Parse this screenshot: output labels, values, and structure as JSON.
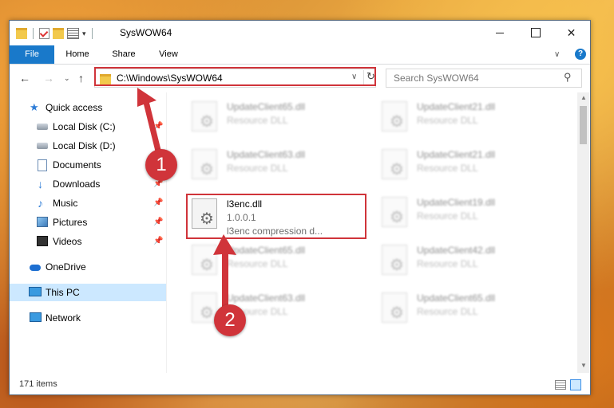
{
  "window": {
    "title": "SysWOW64",
    "minimize_glyph": "",
    "maximize_glyph": "",
    "close_glyph": "✕"
  },
  "ribbon": {
    "tabs": [
      "File",
      "Home",
      "Share",
      "View"
    ],
    "help_glyph": "?",
    "expand_glyph": "∨"
  },
  "nav": {
    "back_glyph": "←",
    "forward_glyph": "→",
    "recent_glyph": "⌄",
    "up_glyph": "↑",
    "address": "C:\\Windows\\SysWOW64",
    "address_chevron": "∨",
    "refresh_glyph": "↻",
    "search_placeholder": "Search SysWOW64",
    "search_glyph": "⚲"
  },
  "sidebar": {
    "items": [
      {
        "label": "Quick access",
        "icon": "star-icon",
        "pinned": false
      },
      {
        "label": "Local Disk (C:)",
        "icon": "disk-icon",
        "pinned": true
      },
      {
        "label": "Local Disk (D:)",
        "icon": "disk-icon",
        "pinned": false
      },
      {
        "label": "Documents",
        "icon": "document-icon",
        "pinned": true
      },
      {
        "label": "Downloads",
        "icon": "download-icon",
        "pinned": true
      },
      {
        "label": "Music",
        "icon": "music-icon",
        "pinned": true
      },
      {
        "label": "Pictures",
        "icon": "pictures-icon",
        "pinned": true
      },
      {
        "label": "Videos",
        "icon": "videos-icon",
        "pinned": true
      },
      {
        "label": "OneDrive",
        "icon": "cloud-icon",
        "pinned": false
      },
      {
        "label": "This PC",
        "icon": "pc-icon",
        "pinned": false,
        "selected": true
      },
      {
        "label": "Network",
        "icon": "network-icon",
        "pinned": false
      }
    ],
    "pin_glyph": "📌"
  },
  "files": [
    {
      "name": "UpdateClient65.dll",
      "line2": "Resource DLL",
      "line3": "",
      "blurred": true
    },
    {
      "name": "UpdateClient21.dll",
      "line2": "Resource DLL",
      "line3": "",
      "blurred": true
    },
    {
      "name": "UpdateClient63.dll",
      "line2": "Resource DLL",
      "line3": "",
      "blurred": true
    },
    {
      "name": "UpdateClient21.dll",
      "line2": "Resource DLL",
      "line3": "",
      "blurred": true
    },
    {
      "name": "l3enc.dll",
      "line2": "1.0.0.1",
      "line3": "l3enc compression d...",
      "blurred": false
    },
    {
      "name": "UpdateClient19.dll",
      "line2": "Resource DLL",
      "line3": "",
      "blurred": true
    },
    {
      "name": "UpdateClient65.dll",
      "line2": "Resource DLL",
      "line3": "",
      "blurred": true
    },
    {
      "name": "UpdateClient42.dll",
      "line2": "Resource DLL",
      "line3": "",
      "blurred": true
    },
    {
      "name": "UpdateClient63.dll",
      "line2": "Resource DLL",
      "line3": "",
      "blurred": true
    },
    {
      "name": "UpdateClient65.dll",
      "line2": "Resource DLL",
      "line3": "",
      "blurred": true
    }
  ],
  "file_gear_glyph": "⚙",
  "status": {
    "item_count": "171 items"
  },
  "callouts": [
    "1",
    "2"
  ],
  "colors": {
    "accent": "#1979ca",
    "highlight": "#d0343a",
    "selected_bg": "#cce8ff"
  }
}
